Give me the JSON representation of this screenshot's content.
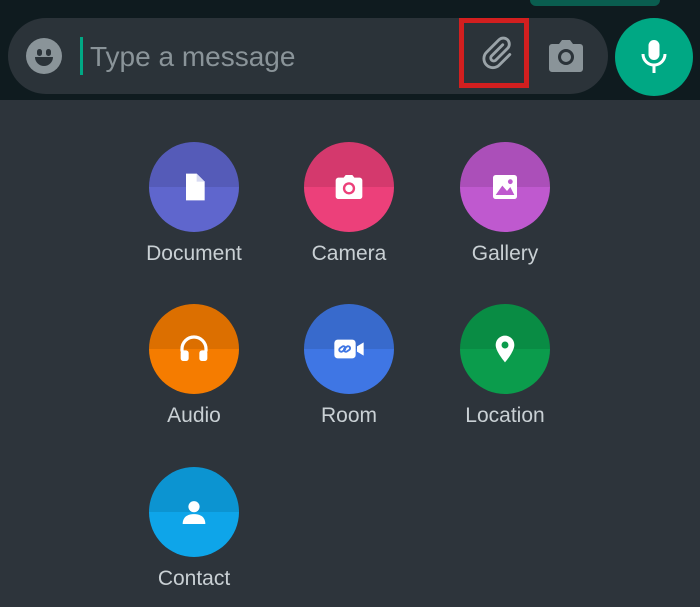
{
  "composer": {
    "placeholder": "Type a message",
    "value": ""
  },
  "icons": {
    "emoji": "emoji-icon",
    "attach": "paperclip-icon",
    "camera": "camera-icon",
    "mic": "mic-icon"
  },
  "colors": {
    "accent": "#00a884",
    "highlight_box": "#d21f1f",
    "panel_bg": "#2d343b",
    "composer_bg": "#2b3339"
  },
  "attach_menu": {
    "items": [
      {
        "label": "Document",
        "icon": "document-icon",
        "color": "#5f66cd"
      },
      {
        "label": "Camera",
        "icon": "camera-icon",
        "color": "#ec407a"
      },
      {
        "label": "Gallery",
        "icon": "gallery-icon",
        "color": "#bf59cf"
      },
      {
        "label": "Audio",
        "icon": "headphones-icon",
        "color": "#f57c00"
      },
      {
        "label": "Room",
        "icon": "video-link-icon",
        "color": "#3f76e4"
      },
      {
        "label": "Location",
        "icon": "location-pin-icon",
        "color": "#0b9c4c"
      },
      {
        "label": "Contact",
        "icon": "contact-icon",
        "color": "#0ea5e9"
      }
    ]
  }
}
